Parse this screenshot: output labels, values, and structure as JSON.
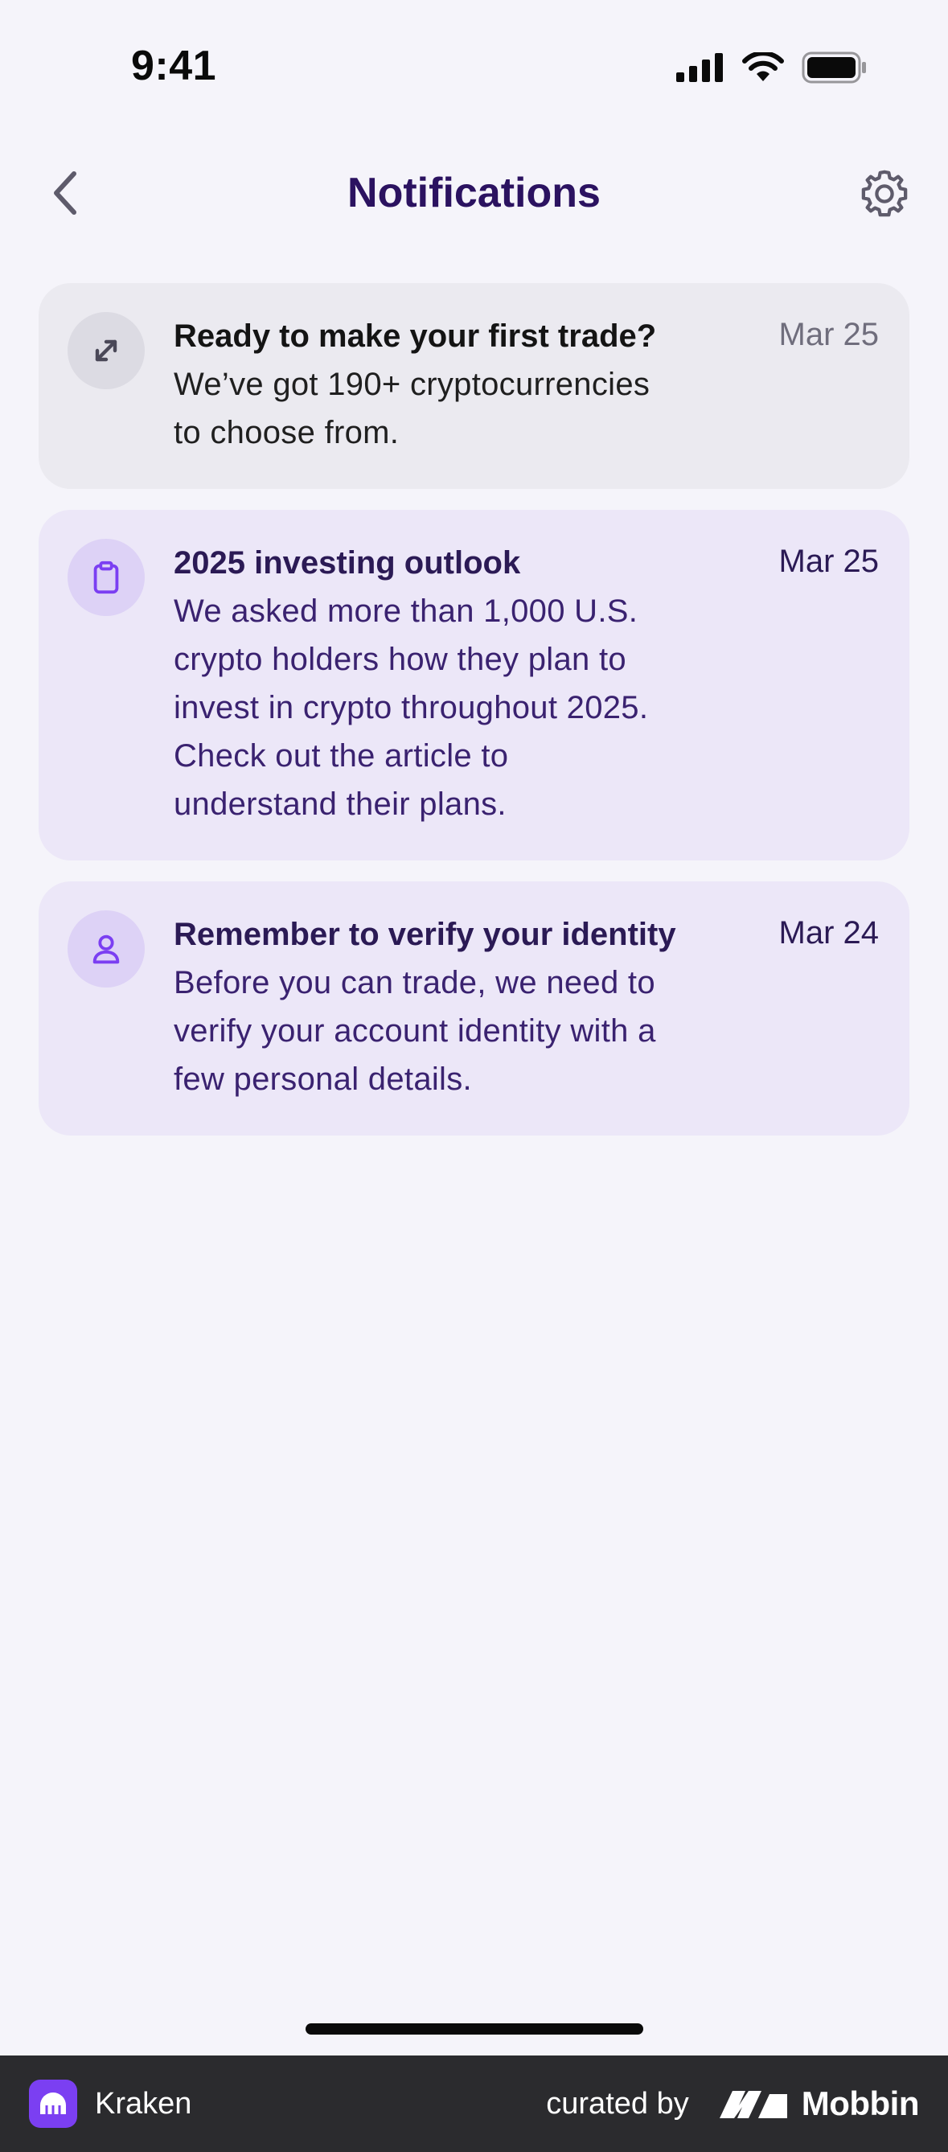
{
  "status_bar": {
    "time": "9:41"
  },
  "header": {
    "title": "Notifications",
    "back_icon": "chevron-left-icon",
    "settings_icon": "gear-icon"
  },
  "notifications": [
    {
      "icon": "trade-arrows-icon",
      "state": "read",
      "title": "Ready to make your first trade?",
      "body": "We’ve got 190+ cryptocurrencies to choose from.",
      "date": "Mar 25"
    },
    {
      "icon": "clipboard-icon",
      "state": "unread",
      "title": "2025 investing outlook",
      "body": "We asked more than 1,000 U.S. crypto holders how they plan to invest in crypto throughout 2025. Check out the article to understand their plans.",
      "date": "Mar 25"
    },
    {
      "icon": "user-icon",
      "state": "unread",
      "title": "Remember to verify your identity",
      "body": "Before you can trade, we need to verify your account identity with a few personal details.",
      "date": "Mar 24"
    }
  ],
  "brand_bar": {
    "app_name": "Kraken",
    "curated_label": "curated by",
    "curator_name": "Mobbin"
  },
  "colors": {
    "accent": "#7b3ff2",
    "title": "#2b1260",
    "unread_card": "#ece7f8",
    "read_card": "#ebeaf0"
  }
}
